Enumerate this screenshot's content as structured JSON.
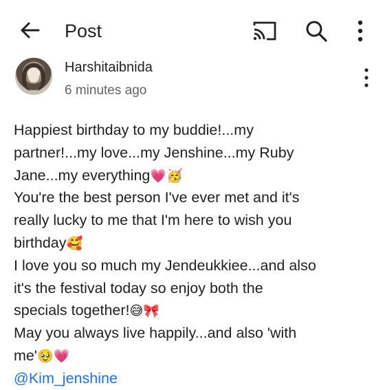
{
  "header": {
    "title": "Post",
    "icons": [
      "back-arrow-icon",
      "cast-icon",
      "search-icon",
      "more-vert-icon"
    ]
  },
  "post": {
    "author": "Harshitaibnida",
    "time": "6 minutes ago",
    "lines": [
      "Happiest birthday to my buddie!...my",
      "partner!...my love...my Jenshine...my Ruby",
      "Jane...my everything",
      "You're the best person I've ever met and it's",
      "really lucky to me that I'm here to wish you",
      "birthday",
      "I love you so much my Jendeukkiee...and also",
      "it's the festival today so enjoy both the",
      "specials together!",
      "May you always live happily...and also 'with",
      "me'"
    ],
    "emoji": {
      "line3": "💗🥳",
      "line6": "🥰",
      "line9": "😅🎀",
      "line11": "🥹💗"
    },
    "mention": "@Kim_jenshine"
  },
  "colors": {
    "mention": "#1a73e8",
    "text": "#202124",
    "secondary": "#5f6368"
  }
}
